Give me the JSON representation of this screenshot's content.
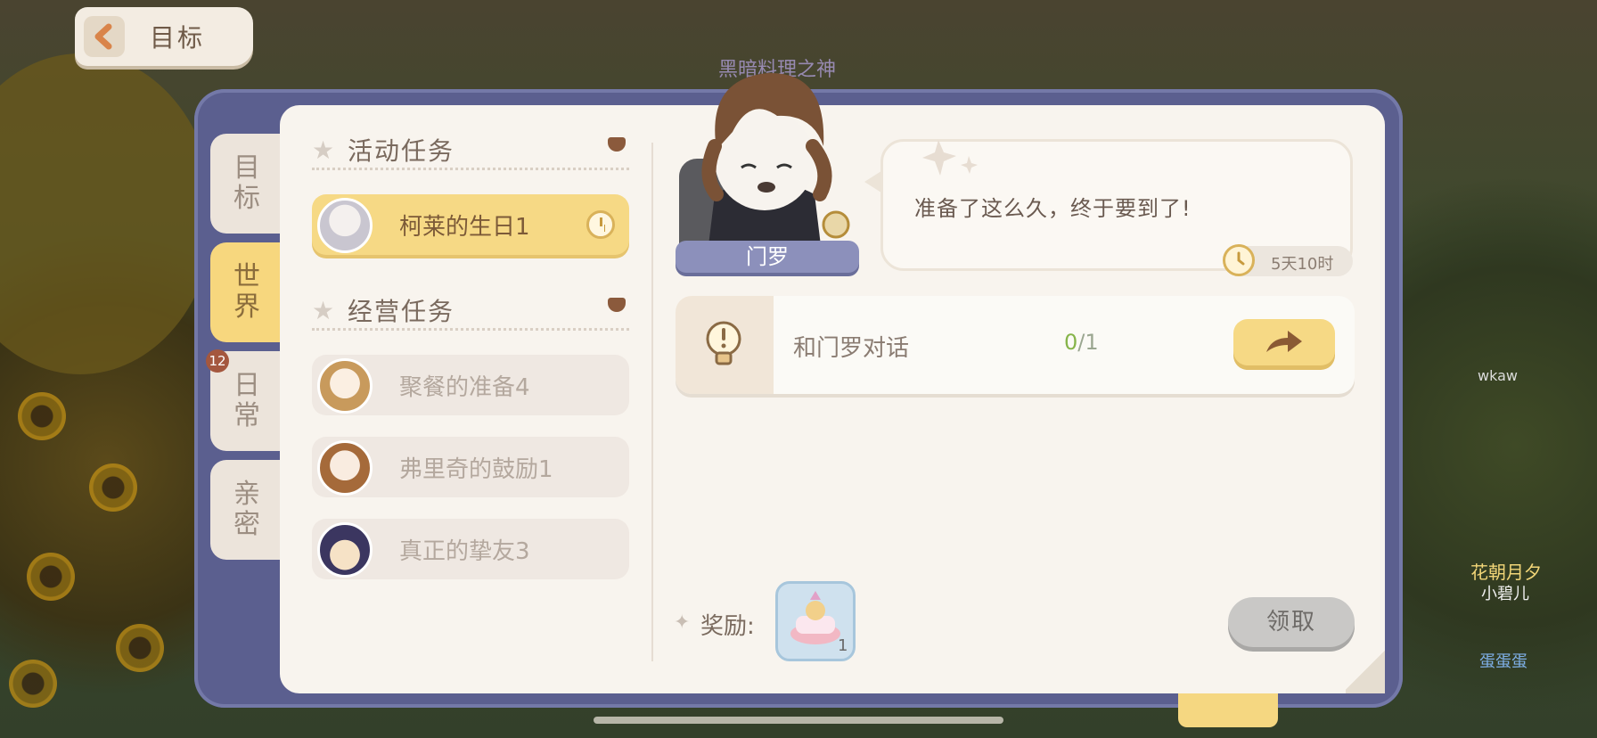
{
  "back_button": {
    "label": "目标",
    "icon": "back-arrow-icon"
  },
  "side_tabs": [
    {
      "label": "目标",
      "active": false
    },
    {
      "label": "世界",
      "active": true
    },
    {
      "label": "日常",
      "active": false,
      "badge": "12"
    },
    {
      "label": "亲密",
      "active": false
    }
  ],
  "sections": [
    {
      "title": "活动任务",
      "tasks": [
        {
          "label": "柯莱的生日1",
          "active": true,
          "timed": true
        }
      ]
    },
    {
      "title": "经营任务",
      "tasks": [
        {
          "label": "聚餐的准备4",
          "active": false
        },
        {
          "label": "弗里奇的鼓励1",
          "active": false
        },
        {
          "label": "真正的挚友3",
          "active": false
        }
      ]
    }
  ],
  "npc": {
    "name": "门罗",
    "dialogue": "准备了这么久，终于要到了!",
    "time_left": "5天10时"
  },
  "objective": {
    "text": "和门罗对话",
    "current": "0",
    "total": "1"
  },
  "reward": {
    "label": "奖励:",
    "item_count": "1",
    "item_icon": "cake-icon"
  },
  "claim_button": {
    "label": "领取"
  },
  "background": {
    "banner": "黑暗料理之神",
    "player_names": [
      "花朝月夕",
      "小碧儿",
      "wkaw",
      "蛋蛋蛋"
    ]
  },
  "colors": {
    "accent": "#f6d985",
    "frame": "#5b5f8f",
    "panel": "#f8f4ee",
    "npc_tag": "#8c90bb",
    "progress_current": "#86b44a"
  }
}
